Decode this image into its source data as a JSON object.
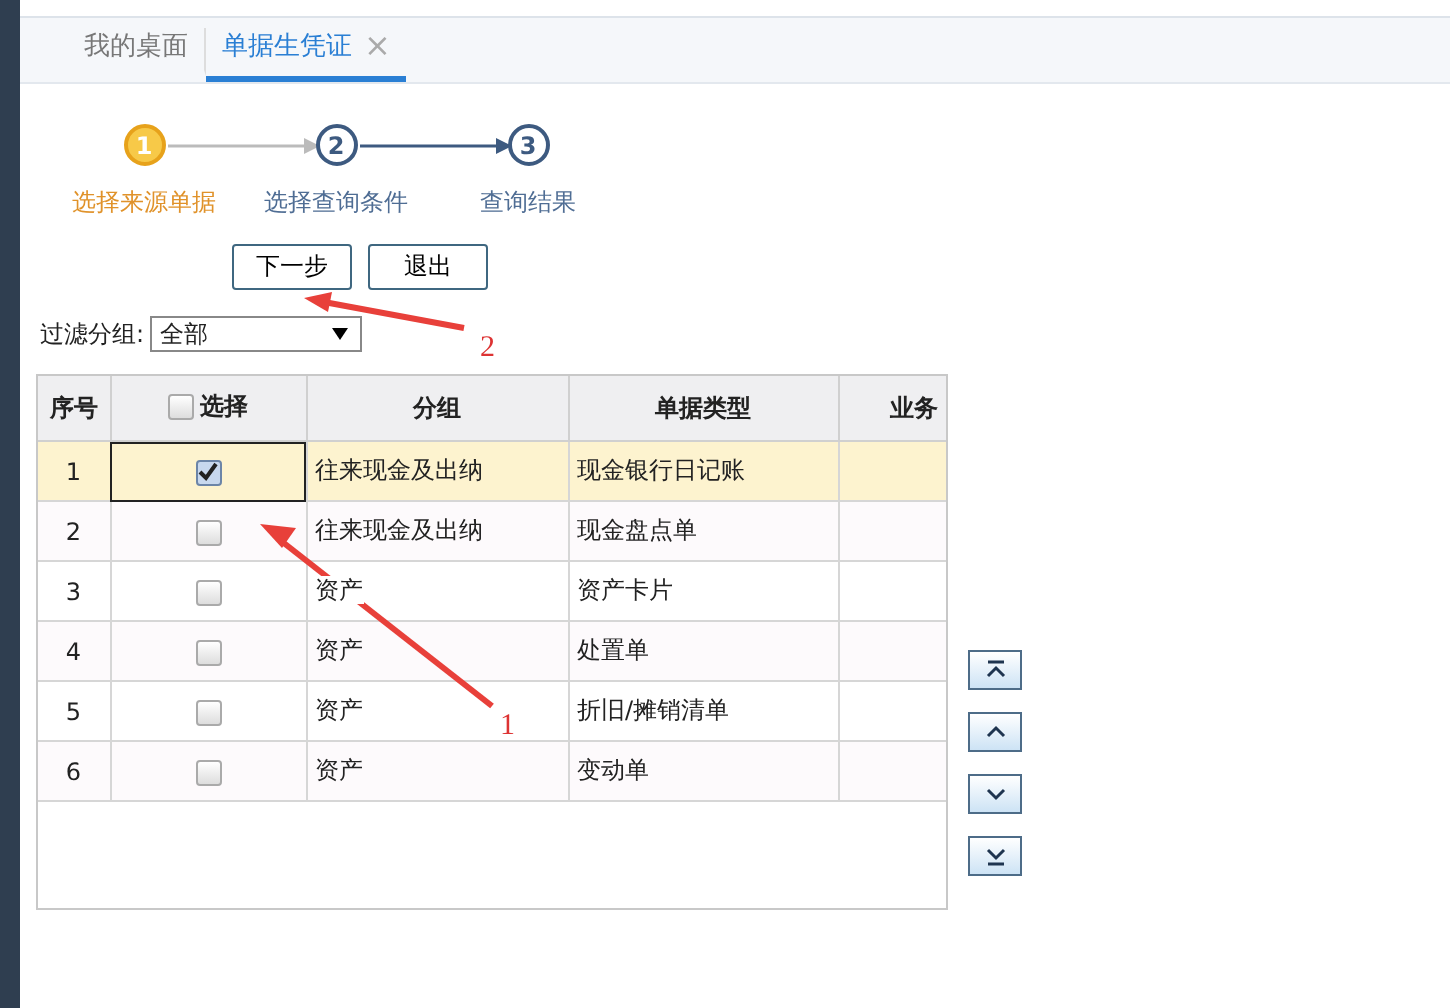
{
  "tabs": [
    {
      "label": "我的桌面",
      "selected": false,
      "closable": false
    },
    {
      "label": "单据生凭证",
      "selected": true,
      "closable": true,
      "close": "×"
    }
  ],
  "steps": [
    {
      "number": "1",
      "label": "选择来源单据",
      "selected": true
    },
    {
      "number": "2",
      "label": "选择查询条件",
      "selected": false
    },
    {
      "number": "3",
      "label": "查询结果",
      "selected": false
    }
  ],
  "buttons": [
    "下一步",
    "退出"
  ],
  "filter": {
    "label": "过滤分组:",
    "value": "全部"
  },
  "table": {
    "columns": [
      "序号",
      "选择",
      "分组",
      "单据类型",
      "业务"
    ],
    "select_all_checked": false,
    "rows": [
      {
        "index": "1",
        "checked": true,
        "selected": true,
        "group": "往来现金及出纳",
        "type": "现金银行日记账"
      },
      {
        "index": "2",
        "checked": false,
        "selected": false,
        "group": "往来现金及出纳",
        "type": "现金盘点单"
      },
      {
        "index": "3",
        "checked": false,
        "selected": false,
        "group": "资产",
        "type": "资产卡片"
      },
      {
        "index": "4",
        "checked": false,
        "selected": false,
        "group": "资产",
        "type": "处置单"
      },
      {
        "index": "5",
        "checked": false,
        "selected": false,
        "group": "资产",
        "type": "折旧/摊销清单"
      },
      {
        "index": "6",
        "checked": false,
        "selected": false,
        "group": "资产",
        "type": "变动单"
      }
    ]
  },
  "move_buttons": [
    {
      "kind": "top"
    },
    {
      "kind": "up"
    },
    {
      "kind": "down"
    },
    {
      "kind": "bottom"
    }
  ],
  "annotations": [
    {
      "label": "2"
    },
    {
      "label": "1"
    }
  ]
}
